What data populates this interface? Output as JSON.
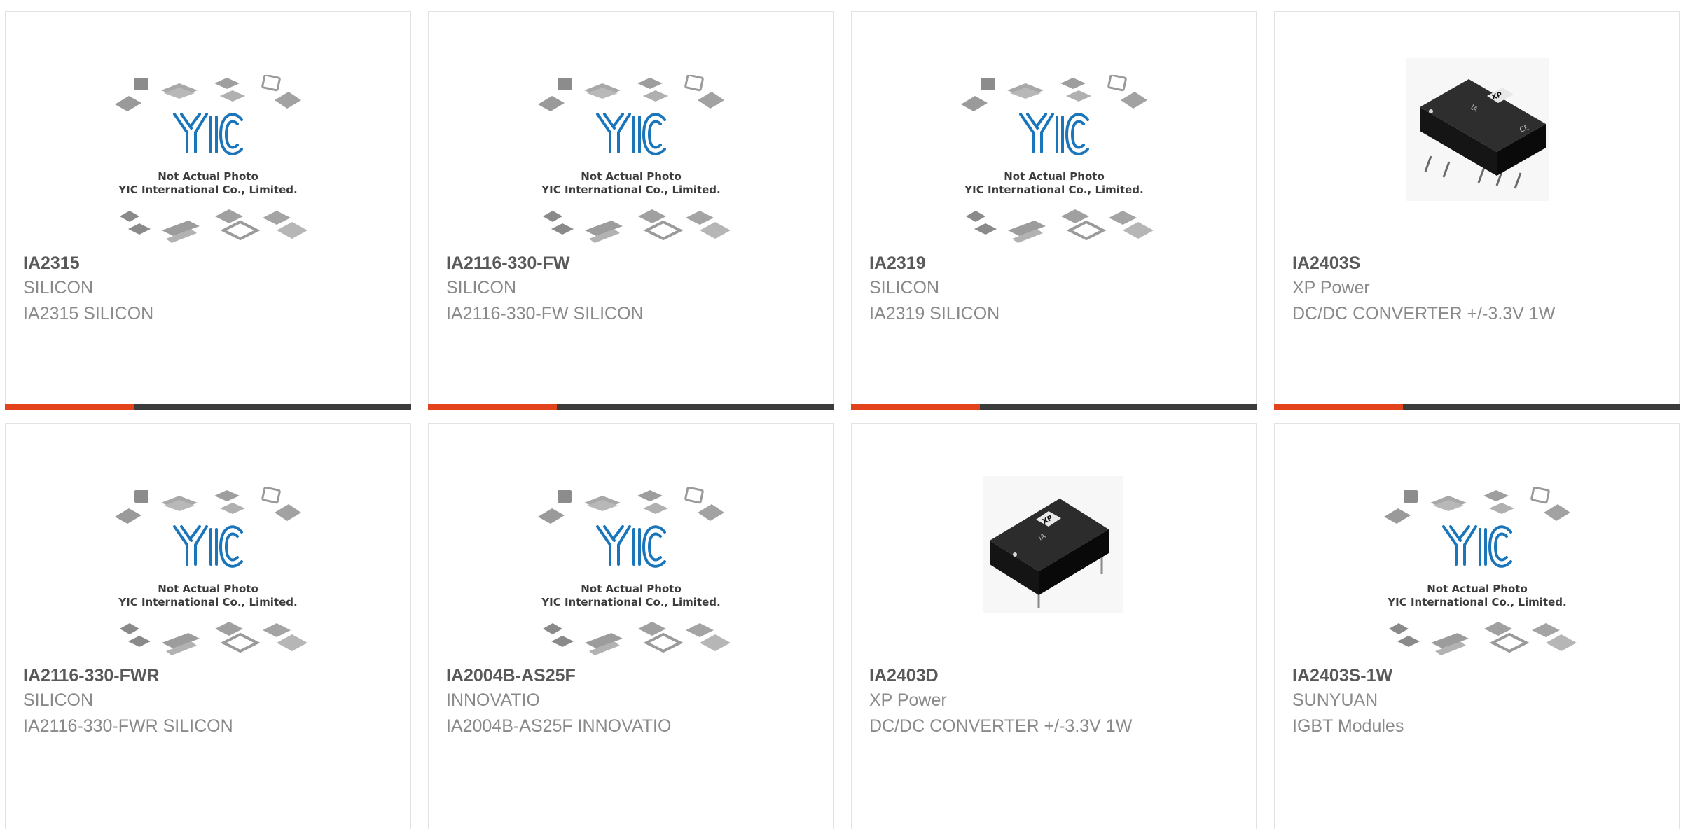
{
  "placeholder": {
    "line1": "Not Actual Photo",
    "line2": "YIC International Co., Limited.",
    "logo_text": "YIC"
  },
  "colors": {
    "accent": "#e3431c",
    "bar": "#3b3b3b",
    "part_number": "#595959",
    "secondary_text": "#8a8a8a",
    "logo_blue": "#1a75bb"
  },
  "products": [
    {
      "part_number": "IA2315",
      "manufacturer": "SILICON",
      "description": "IA2315 SILICON",
      "image": "placeholder-image"
    },
    {
      "part_number": "IA2116-330-FW",
      "manufacturer": "SILICON",
      "description": "IA2116-330-FW SILICON",
      "image": "placeholder-image"
    },
    {
      "part_number": "IA2319",
      "manufacturer": "SILICON",
      "description": "IA2319 SILICON",
      "image": "placeholder-image"
    },
    {
      "part_number": "IA2403S",
      "manufacturer": "XP Power",
      "description": "DC/DC CONVERTER +/-3.3V 1W",
      "image": "sip-module-photo",
      "module_label": "IA",
      "brand_label": "XP",
      "mark_label": "CE"
    },
    {
      "part_number": "IA2116-330-FWR",
      "manufacturer": "SILICON",
      "description": "IA2116-330-FWR SILICON",
      "image": "placeholder-image"
    },
    {
      "part_number": "IA2004B-AS25F",
      "manufacturer": "INNOVATIO",
      "description": "IA2004B-AS25F INNOVATIO",
      "image": "placeholder-image"
    },
    {
      "part_number": "IA2403D",
      "manufacturer": "XP Power",
      "description": "DC/DC CONVERTER +/-3.3V 1W",
      "image": "dip-module-photo",
      "module_label": "IA",
      "brand_label": "XP"
    },
    {
      "part_number": "IA2403S-1W",
      "manufacturer": "SUNYUAN",
      "description": "IGBT Modules",
      "image": "placeholder-image"
    }
  ]
}
